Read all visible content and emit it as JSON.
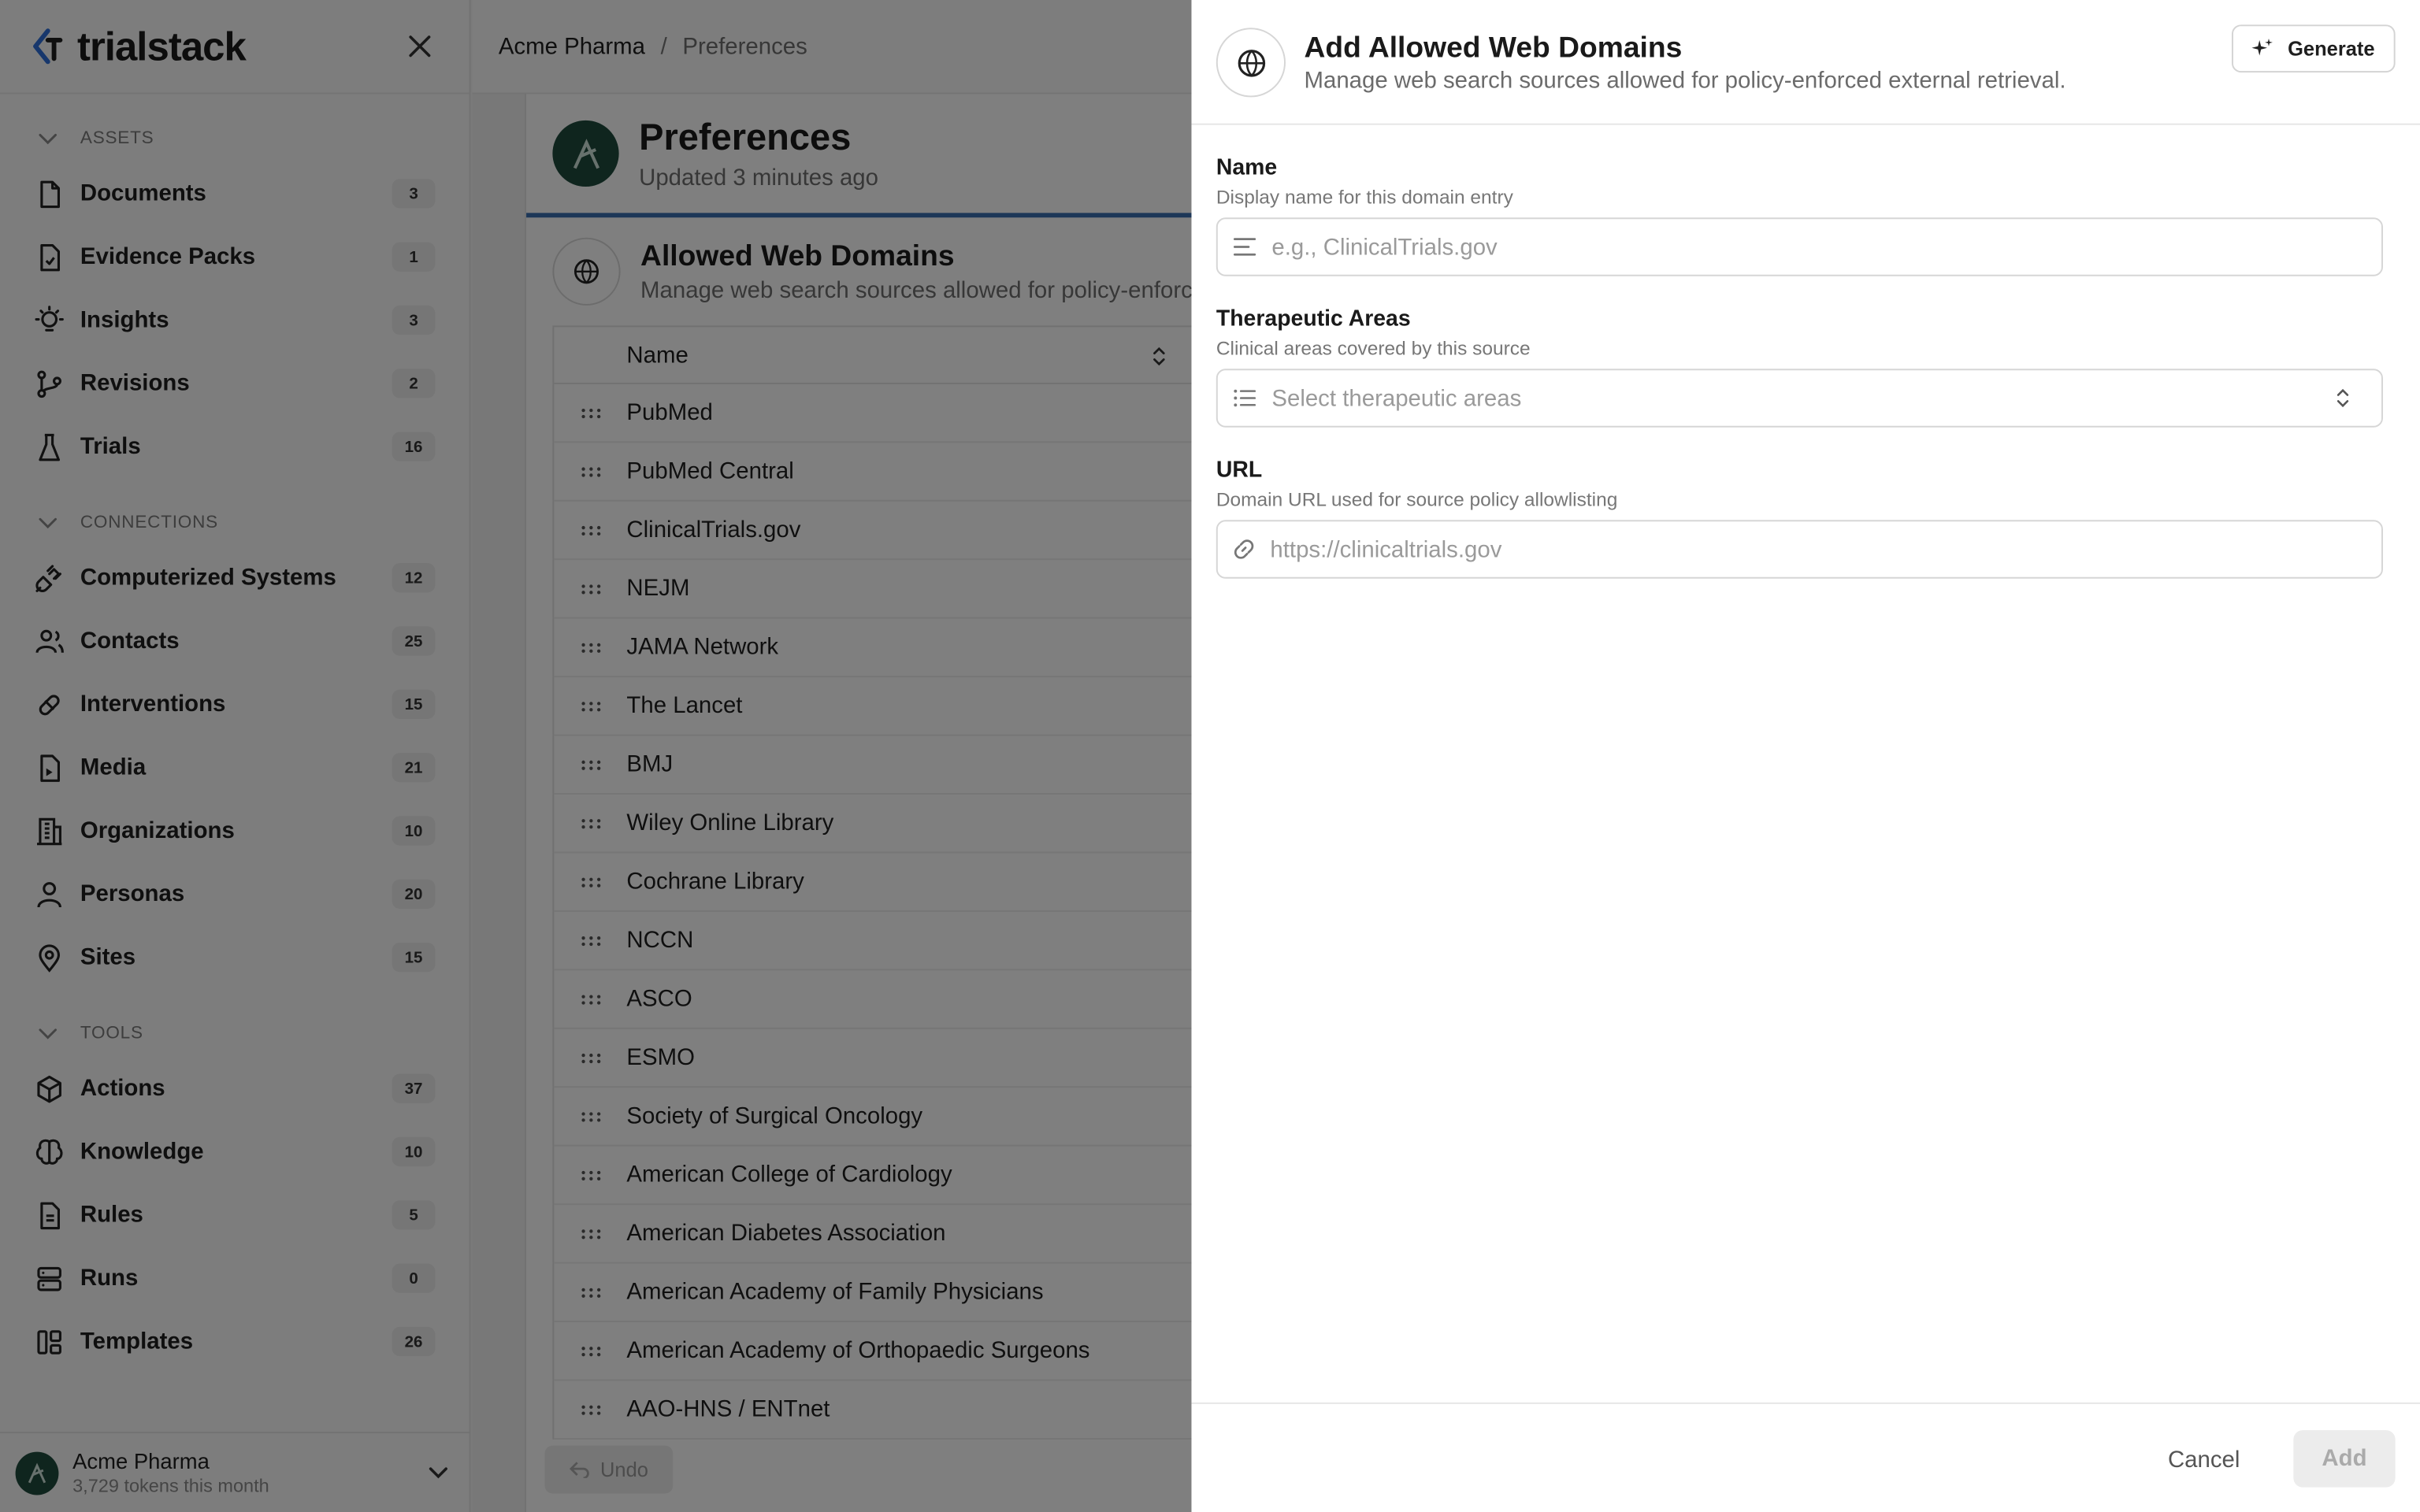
{
  "brand": {
    "name": "trialstack"
  },
  "sidebar": {
    "sections": [
      {
        "title": "ASSETS",
        "items": [
          {
            "label": "Documents",
            "count": "3",
            "icon": "document-icon"
          },
          {
            "label": "Evidence Packs",
            "count": "1",
            "icon": "evidence-pack-icon"
          },
          {
            "label": "Insights",
            "count": "3",
            "icon": "lightbulb-icon"
          },
          {
            "label": "Revisions",
            "count": "2",
            "icon": "git-branch-icon"
          },
          {
            "label": "Trials",
            "count": "16",
            "icon": "flask-icon"
          }
        ]
      },
      {
        "title": "CONNECTIONS",
        "items": [
          {
            "label": "Computerized Systems",
            "count": "12",
            "icon": "plug-icon"
          },
          {
            "label": "Contacts",
            "count": "25",
            "icon": "users-icon"
          },
          {
            "label": "Interventions",
            "count": "15",
            "icon": "pill-icon"
          },
          {
            "label": "Media",
            "count": "21",
            "icon": "media-file-icon"
          },
          {
            "label": "Organizations",
            "count": "10",
            "icon": "building-icon"
          },
          {
            "label": "Personas",
            "count": "20",
            "icon": "person-icon"
          },
          {
            "label": "Sites",
            "count": "15",
            "icon": "map-pin-icon"
          }
        ]
      },
      {
        "title": "TOOLS",
        "items": [
          {
            "label": "Actions",
            "count": "37",
            "icon": "box-sparkle-icon"
          },
          {
            "label": "Knowledge",
            "count": "10",
            "icon": "brain-icon"
          },
          {
            "label": "Rules",
            "count": "5",
            "icon": "rule-document-icon"
          },
          {
            "label": "Runs",
            "count": "0",
            "icon": "server-icon"
          },
          {
            "label": "Templates",
            "count": "26",
            "icon": "template-icon"
          }
        ]
      }
    ]
  },
  "account": {
    "name": "Acme Pharma",
    "usage": "3,729 tokens this month"
  },
  "breadcrumb": {
    "org": "Acme Pharma",
    "separator": "/",
    "page": "Preferences"
  },
  "preferences": {
    "title": "Preferences",
    "updated": "Updated 3 minutes ago"
  },
  "domains_section": {
    "title": "Allowed Web Domains",
    "subtitle": "Manage web search sources allowed for policy-enforc",
    "column_name": "Name",
    "rows": [
      "PubMed",
      "PubMed Central",
      "ClinicalTrials.gov",
      "NEJM",
      "JAMA Network",
      "The Lancet",
      "BMJ",
      "Wiley Online Library",
      "Cochrane Library",
      "NCCN",
      "ASCO",
      "ESMO",
      "Society of Surgical Oncology",
      "American College of Cardiology",
      "American Diabetes Association",
      "American Academy of Family Physicians",
      "American Academy of Orthopaedic Surgeons",
      "AAO-HNS / ENTnet"
    ],
    "undo_label": "Undo"
  },
  "drawer": {
    "title": "Add Allowed Web Domains",
    "subtitle": "Manage web search sources allowed for policy-enforced external retrieval.",
    "generate_label": "Generate",
    "fields": {
      "name": {
        "label": "Name",
        "help": "Display name for this domain entry",
        "placeholder": "e.g., ClinicalTrials.gov",
        "value": ""
      },
      "areas": {
        "label": "Therapeutic Areas",
        "help": "Clinical areas covered by this source",
        "placeholder": "Select therapeutic areas"
      },
      "url": {
        "label": "URL",
        "help": "Domain URL used for source policy allowlisting",
        "placeholder": "https://clinicaltrials.gov",
        "value": ""
      }
    },
    "cancel_label": "Cancel",
    "add_label": "Add"
  },
  "colors": {
    "accent_blue": "#3b6fb0",
    "avatar_green": "#1e4a3d",
    "brand_blue": "#2e6fd8"
  }
}
